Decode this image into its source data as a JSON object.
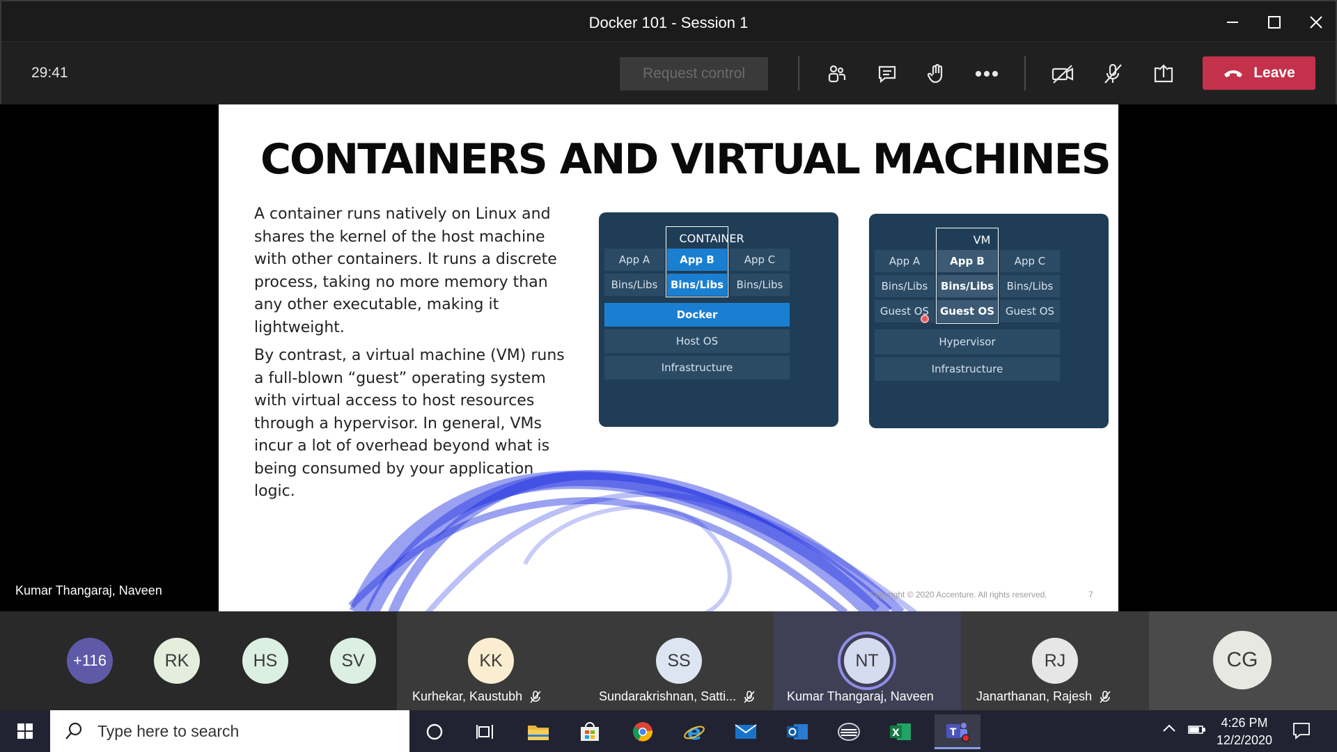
{
  "window": {
    "title": "Docker 101 - Session 1"
  },
  "toolbar": {
    "timer": "29:41",
    "request_control": "Request control",
    "leave": "Leave"
  },
  "stage": {
    "presenter_name": "Kumar Thangaraj, Naveen"
  },
  "slide": {
    "title": "CONTAINERS AND VIRTUAL MACHINES",
    "para1": "A container runs natively on Linux and shares the kernel of the host machine with other containers. It runs a discrete process, taking no more memory than any other executable, making it lightweight.",
    "para2": "By contrast, a virtual machine (VM) runs a full-blown “guest” operating system with virtual access to host resources through a hypervisor. In general, VMs incur a lot of overhead beyond what is being consumed by your application logic.",
    "copyright": "Copyright © 2020 Accenture. All rights reserved.",
    "page_number": "7",
    "container_diagram": {
      "header": "CONTAINER",
      "app_a": "App A",
      "app_b": "App B",
      "app_c": "App C",
      "bins_a": "Bins/Libs",
      "bins_b": "Bins/Libs",
      "bins_c": "Bins/Libs",
      "docker": "Docker",
      "host_os": "Host OS",
      "infrastructure": "Infrastructure"
    },
    "vm_diagram": {
      "header": "VM",
      "app_a": "App A",
      "app_b": "App B",
      "app_c": "App C",
      "bins_a": "Bins/Libs",
      "bins_b": "Bins/Libs",
      "bins_c": "Bins/Libs",
      "guest_a": "Guest OS",
      "guest_b": "Guest OS",
      "guest_c": "Guest OS",
      "hypervisor": "Hypervisor",
      "infrastructure": "Infrastructure"
    }
  },
  "participants": {
    "overflow": "+116",
    "avatars": [
      {
        "initials": "RK",
        "color": "#e3eedd"
      },
      {
        "initials": "HS",
        "color": "#dcefe3"
      },
      {
        "initials": "SV",
        "color": "#dcefe3"
      }
    ],
    "tiles": [
      {
        "initials": "KK",
        "name": "Kurhekar, Kaustubh",
        "color": "#fbeed0"
      },
      {
        "initials": "SS",
        "name": "Sundarakrishnan, Satti...",
        "color": "#dde5f2"
      },
      {
        "initials": "NT",
        "name": "Kumar Thangaraj, Naveen",
        "color": "#d6dcf0"
      },
      {
        "initials": "RJ",
        "name": "Janarthanan, Rajesh",
        "color": "#e6e6e6"
      },
      {
        "initials": "CG",
        "name": "",
        "color": "#e8e8e2"
      }
    ]
  },
  "taskbar": {
    "search_placeholder": "Type here to search",
    "time": "4:26 PM",
    "date": "12/2/2020"
  },
  "colors": {
    "leave": "#c4314b",
    "docker": "#1a7fd1",
    "diagram_bg": "#1f3d56",
    "overflow_avatar": "#5f5aa8"
  }
}
